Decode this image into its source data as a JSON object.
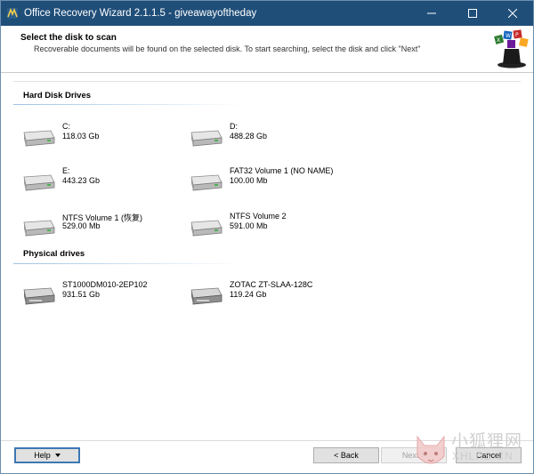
{
  "window": {
    "title": "Office Recovery Wizard 2.1.1.5 - giveawayoftheday",
    "app_icon": "app-icon",
    "controls": {
      "minimize_icon": "minimize-icon",
      "maximize_icon": "maximize-icon",
      "close_icon": "close-icon"
    }
  },
  "header": {
    "title": "Select the disk to scan",
    "subtitle": "Recoverable documents will be found on the selected disk. To start searching, select the disk and click \"Next\"",
    "logo_icon": "wizard-hat-logo"
  },
  "sections": {
    "hard_disk": {
      "title": "Hard Disk Drives",
      "drives": [
        {
          "name": "C:",
          "size": "118.03 Gb"
        },
        {
          "name": "D:",
          "size": "488.28 Gb"
        },
        {
          "name": "E:",
          "size": "443.23 Gb"
        },
        {
          "name": "FAT32 Volume 1 (NO NAME)",
          "size": "100.00 Mb"
        },
        {
          "name": "NTFS Volume 1 (恢复)",
          "size": "529.00 Mb"
        },
        {
          "name": "NTFS Volume 2",
          "size": "591.00 Mb"
        }
      ]
    },
    "physical": {
      "title": "Physical drives",
      "drives": [
        {
          "name": "ST1000DM010-2EP102",
          "size": "931.51 Gb"
        },
        {
          "name": "ZOTAC ZT-SLAA-128C",
          "size": "119.24 Gb"
        }
      ]
    }
  },
  "footer": {
    "help_label": "Help",
    "back_label": "< Back",
    "next_label": "Next >",
    "cancel_label": "Cancel"
  },
  "watermark": {
    "text": "小狐狸网",
    "subtext": "XHLRS.CN"
  },
  "colors": {
    "titlebar": "#1f4e79",
    "accent": "#3c78b4",
    "drive_led": "#4caf50"
  }
}
